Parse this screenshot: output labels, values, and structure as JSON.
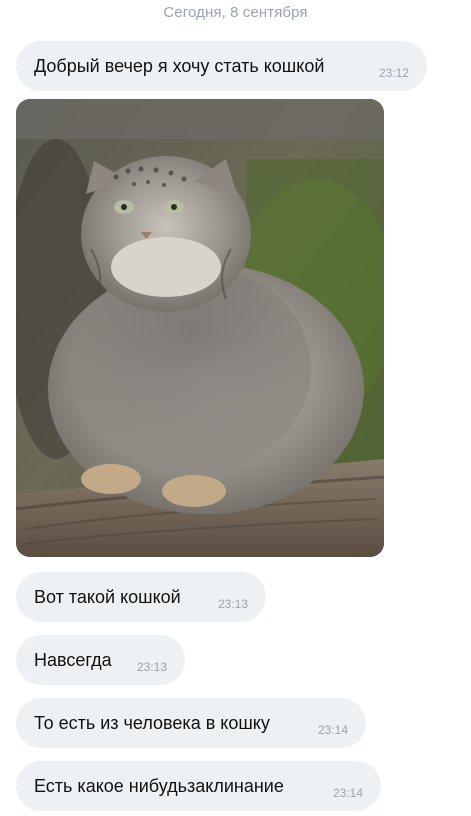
{
  "date_separator": "Сегодня, 8 сентября",
  "messages": [
    {
      "text": "Добрый вечер я хочу стать кошкой",
      "time": "23:12"
    },
    {
      "type": "photo",
      "subject": "cat"
    },
    {
      "text": "Вот такой кошкой",
      "time": "23:13"
    },
    {
      "text": "Навсегда",
      "time": "23:13"
    },
    {
      "text": "То есть из человека в кошку",
      "time": "23:14"
    },
    {
      "text": "Есть какое нибудьзаклинание",
      "time": "23:14"
    }
  ],
  "colors": {
    "bubble": "#eef1f4",
    "timestamp": "#9aa3ad",
    "text": "#111111"
  }
}
